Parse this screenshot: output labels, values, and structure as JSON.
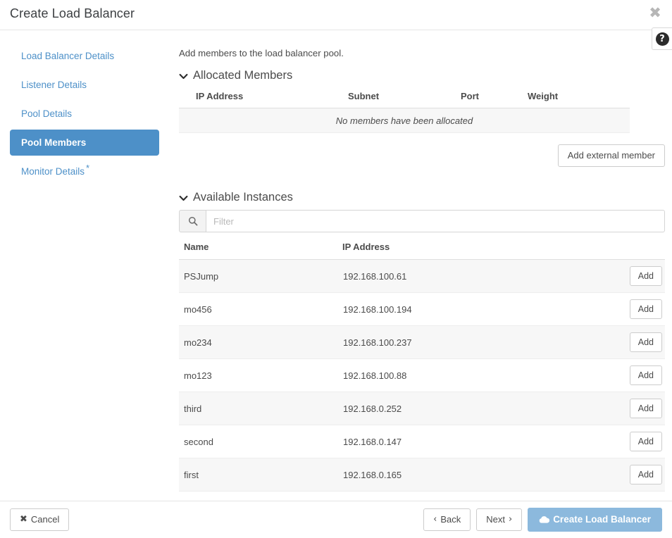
{
  "header": {
    "title": "Create Load Balancer",
    "close_icon": "close-icon",
    "help_icon": "question-mark-icon",
    "help_glyph": "?",
    "close_glyph": "✖"
  },
  "sidebar": {
    "items": [
      {
        "label": "Load Balancer Details",
        "active": false,
        "required_marker": ""
      },
      {
        "label": "Listener Details",
        "active": false,
        "required_marker": ""
      },
      {
        "label": "Pool Details",
        "active": false,
        "required_marker": ""
      },
      {
        "label": "Pool Members",
        "active": true,
        "required_marker": ""
      },
      {
        "label": "Monitor Details",
        "active": false,
        "required_marker": "*"
      }
    ]
  },
  "main": {
    "intro": "Add members to the load balancer pool.",
    "allocated": {
      "heading": "Allocated Members",
      "columns": [
        "IP Address",
        "Subnet",
        "Port",
        "Weight"
      ],
      "empty_message": "No members have been allocated",
      "rows": [],
      "add_external_label": "Add external member"
    },
    "available": {
      "heading": "Available Instances",
      "filter_placeholder": "Filter",
      "filter_value": "",
      "search_icon": "search-icon",
      "columns": [
        "Name",
        "IP Address"
      ],
      "action_label": "Add",
      "rows": [
        {
          "name": "PSJump",
          "ip": "192.168.100.61"
        },
        {
          "name": "mo456",
          "ip": "192.168.100.194"
        },
        {
          "name": "mo234",
          "ip": "192.168.100.237"
        },
        {
          "name": "mo123",
          "ip": "192.168.100.88"
        },
        {
          "name": "third",
          "ip": "192.168.0.252"
        },
        {
          "name": "second",
          "ip": "192.168.0.147"
        },
        {
          "name": "first",
          "ip": "192.168.0.165"
        }
      ]
    }
  },
  "footer": {
    "cancel_label": "Cancel",
    "cancel_glyph": "✖",
    "back_label": "Back",
    "back_glyph": "‹",
    "next_label": "Next",
    "next_glyph": "›",
    "submit_label": "Create Load Balancer",
    "submit_icon": "cloud-icon"
  },
  "colors": {
    "accent": "#4d90c8",
    "primary_button": "#8cb9dd",
    "row_stripe": "#f7f7f7",
    "border": "#e5e5e5",
    "text": "#4b4b4b"
  }
}
